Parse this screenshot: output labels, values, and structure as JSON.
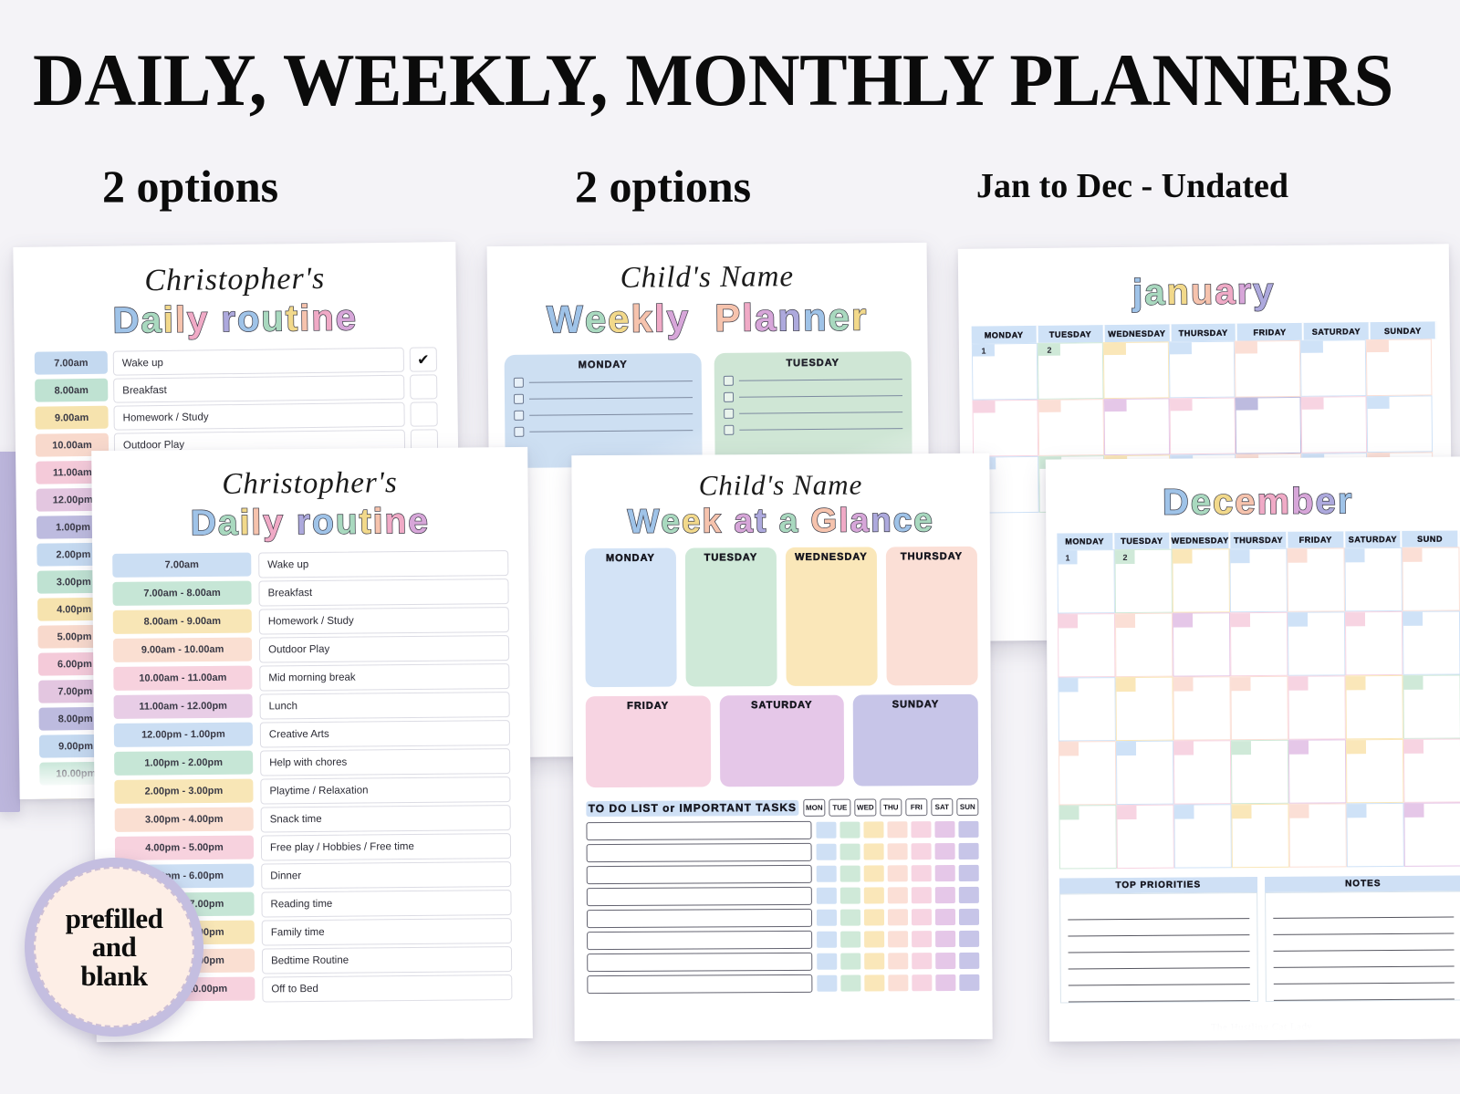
{
  "header": {
    "title": "DAILY, WEEKLY, MONTHLY PLANNERS",
    "sub_daily": "2 options",
    "sub_weekly": "2 options",
    "sub_monthly": "Jan to Dec - Undated"
  },
  "badge": {
    "line1": "prefilled",
    "line2": "and",
    "line3": "blank"
  },
  "watermark": "The Hustling Cat Lady",
  "daily_routine_1": {
    "name": "Christopher's",
    "title": "Daily routine",
    "title_letters": [
      "D",
      "a",
      "i",
      "l",
      "y",
      " ",
      "r",
      "o",
      "u",
      "t",
      "i",
      "n",
      "e"
    ],
    "checked_first": "✔",
    "rows": [
      {
        "time": "7.00am",
        "task": "Wake up",
        "color": "#c4d9f0"
      },
      {
        "time": "8.00am",
        "task": "Breakfast",
        "color": "#bfe2d2"
      },
      {
        "time": "9.00am",
        "task": "Homework / Study",
        "color": "#f6e3ae"
      },
      {
        "time": "10.00am",
        "task": "Outdoor Play",
        "color": "#f8d9cc"
      },
      {
        "time": "11.00am",
        "task": "",
        "color": "#f4cad9"
      },
      {
        "time": "12.00pm",
        "task": "",
        "color": "#e3c6e0"
      },
      {
        "time": "1.00pm",
        "task": "",
        "color": "#bdbbdf"
      },
      {
        "time": "2.00pm",
        "task": "",
        "color": "#c4d9f0"
      },
      {
        "time": "3.00pm",
        "task": "",
        "color": "#bfe2d2"
      },
      {
        "time": "4.00pm",
        "task": "",
        "color": "#f6e3ae"
      },
      {
        "time": "5.00pm",
        "task": "",
        "color": "#f8d9cc"
      },
      {
        "time": "6.00pm",
        "task": "",
        "color": "#f4cad9"
      },
      {
        "time": "7.00pm",
        "task": "",
        "color": "#e3c6e0"
      },
      {
        "time": "8.00pm",
        "task": "",
        "color": "#bdbbdf"
      },
      {
        "time": "9.00pm",
        "task": "",
        "color": "#c4d9f0"
      },
      {
        "time": "10.00pm",
        "task": "",
        "color": "#bfe2d2"
      },
      {
        "time": "",
        "task": "",
        "color": "#f6e3ae"
      }
    ]
  },
  "daily_routine_2": {
    "name": "Christopher's",
    "title": "Daily routine",
    "title_letters": [
      "D",
      "a",
      "i",
      "l",
      "y",
      " ",
      "r",
      "o",
      "u",
      "t",
      "i",
      "n",
      "e"
    ],
    "rows": [
      {
        "time": "7.00am",
        "task": "Wake up",
        "color": "#cbdef3"
      },
      {
        "time": "7.00am - 8.00am",
        "task": "Breakfast",
        "color": "#c6e6d6"
      },
      {
        "time": "8.00am - 9.00am",
        "task": "Homework / Study",
        "color": "#f8e6b6"
      },
      {
        "time": "9.00am - 10.00am",
        "task": "Outdoor Play",
        "color": "#fadfd2"
      },
      {
        "time": "10.00am - 11.00am",
        "task": "Mid morning break",
        "color": "#f7d2de"
      },
      {
        "time": "11.00am - 12.00pm",
        "task": "Lunch",
        "color": "#e8cde6"
      },
      {
        "time": "12.00pm - 1.00pm",
        "task": "Creative Arts",
        "color": "#cbdef3"
      },
      {
        "time": "1.00pm - 2.00pm",
        "task": "Help with chores",
        "color": "#c6e6d6"
      },
      {
        "time": "2.00pm - 3.00pm",
        "task": "Playtime / Relaxation",
        "color": "#f8e6b6"
      },
      {
        "time": "3.00pm - 4.00pm",
        "task": "Snack time",
        "color": "#fadfd2"
      },
      {
        "time": "4.00pm - 5.00pm",
        "task": "Free play / Hobbies / Free time",
        "color": "#f7d2de"
      },
      {
        "time": "5.00pm - 6.00pm",
        "task": "Dinner",
        "color": "#cbdef3"
      },
      {
        "time": "6.00pm - 7.00pm",
        "task": "Reading time",
        "color": "#c6e6d6"
      },
      {
        "time": "7.00pm - 8.00pm",
        "task": "Family time",
        "color": "#f8e6b6"
      },
      {
        "time": "8.00pm - 9.00pm",
        "task": "Bedtime Routine",
        "color": "#fadfd2"
      },
      {
        "time": "9.00pm - 10.00pm",
        "task": "Off to Bed",
        "color": "#f7d2de"
      }
    ]
  },
  "weekly_planner": {
    "name": "Child's Name",
    "title_words": [
      "Weekly",
      "Planner"
    ],
    "title_letters_a": [
      "W",
      "e",
      "e",
      "k",
      "l",
      "y"
    ],
    "title_letters_b": [
      "P",
      "l",
      "a",
      "n",
      "n",
      "e",
      "r"
    ],
    "days": [
      {
        "label": "MONDAY",
        "color": "#cddff2",
        "lines": 4
      },
      {
        "label": "TUESDAY",
        "color": "#cfe6d5",
        "lines": 4
      }
    ]
  },
  "week_at_a_glance": {
    "name": "Child's Name",
    "title": "Week at a Glance",
    "title_letters": [
      "W",
      "e",
      "e",
      "k",
      " ",
      "a",
      "t",
      " ",
      "a",
      " ",
      "G",
      "l",
      "a",
      "n",
      "c",
      "e"
    ],
    "days_top": [
      {
        "label": "MONDAY",
        "color": "#d3e3f6"
      },
      {
        "label": "TUESDAY",
        "color": "#cfe9d8"
      },
      {
        "label": "WEDNESDAY",
        "color": "#fae7b9"
      },
      {
        "label": "THURSDAY",
        "color": "#fbdfd6"
      }
    ],
    "days_bottom": [
      {
        "label": "FRIDAY",
        "color": "#f7d4e2"
      },
      {
        "label": "SATURDAY",
        "color": "#e5c7e8"
      },
      {
        "label": "SUNDAY",
        "color": "#c7c5e8"
      }
    ],
    "todo_title": "TO DO LIST or IMPORTANT TASKS",
    "day_chips": [
      "MON",
      "TUE",
      "WED",
      "THU",
      "FRI",
      "SAT",
      "SUN"
    ],
    "chip_colors": [
      "#cfe0f5",
      "#cfe9d8",
      "#fae7b9",
      "#fbdfd6",
      "#f7d4e2",
      "#e5c7e8",
      "#c7c5e8"
    ],
    "todo_rows": 8
  },
  "calendar_january": {
    "month": "January",
    "month_letters": [
      "j",
      "a",
      "n",
      "u",
      "a",
      "r",
      "y"
    ],
    "weekdays": [
      "MONDAY",
      "TUESDAY",
      "WEDNESDAY",
      "THURSDAY",
      "FRIDAY",
      "SATURDAY",
      "SUNDAY"
    ],
    "visible_numbers": [
      "1",
      "2",
      "",
      "",
      "",
      "",
      ""
    ],
    "row1_tab_colors": [
      "#cfe2f7",
      "#cfe9d8",
      "#fae7b9",
      "#cfe2f7",
      "#fbdfd6",
      "#cfe2f7",
      "#fbdfd6"
    ],
    "row2_tab_colors": [
      "#f7d4e2",
      "#fbdfd6",
      "#e5c7e8",
      "#f7d4e2",
      "#bdbbdf",
      "#f7d4e2",
      "#cfe2f7"
    ]
  },
  "calendar_december": {
    "month": "December",
    "month_letters": [
      "D",
      "e",
      "c",
      "e",
      "m",
      "b",
      "e",
      "r"
    ],
    "weekdays": [
      "MONDAY",
      "TUESDAY",
      "WEDNESDAY",
      "THURSDAY",
      "FRIDAY",
      "SATURDAY",
      "SUND"
    ],
    "visible_numbers": [
      "1",
      "2",
      "",
      "",
      "",
      "",
      ""
    ],
    "row_tab_colors": [
      [
        "#cfe2f7",
        "#cfe9d8",
        "#fae7b9",
        "#cfe2f7",
        "#fbdfd6",
        "#cfe2f7",
        "#fbdfd6"
      ],
      [
        "#f7d4e2",
        "#fbdfd6",
        "#e5c7e8",
        "#f7d4e2",
        "#cfe2f7",
        "#f7d4e2",
        "#cfe2f7"
      ],
      [
        "#cfe2f7",
        "#fae7b9",
        "#fbdfd6",
        "#fbdfd6",
        "#f7d4e2",
        "#fae7b9",
        "#cfe9d8"
      ],
      [
        "#fbdfd6",
        "#cfe2f7",
        "#f7d4e2",
        "#cfe9d8",
        "#e5c7e8",
        "#fae7b9",
        "#f7d4e2"
      ],
      [
        "#cfe9d8",
        "#f7d4e2",
        "#cfe2f7",
        "#fae7b9",
        "#fbdfd6",
        "#cfe2f7",
        "#e5c7e8"
      ]
    ],
    "panel_priorities": "TOP PRIORITIES",
    "panel_notes": "NOTES"
  },
  "palette": {
    "blue": "#cfe2f7",
    "green": "#cfe9d8",
    "yellow": "#fae7b9",
    "peach": "#fbdfd6",
    "pink": "#f7d4e2",
    "orchid": "#e5c7e8",
    "purple": "#c7c5e8",
    "bg": "#f4f3f7"
  }
}
